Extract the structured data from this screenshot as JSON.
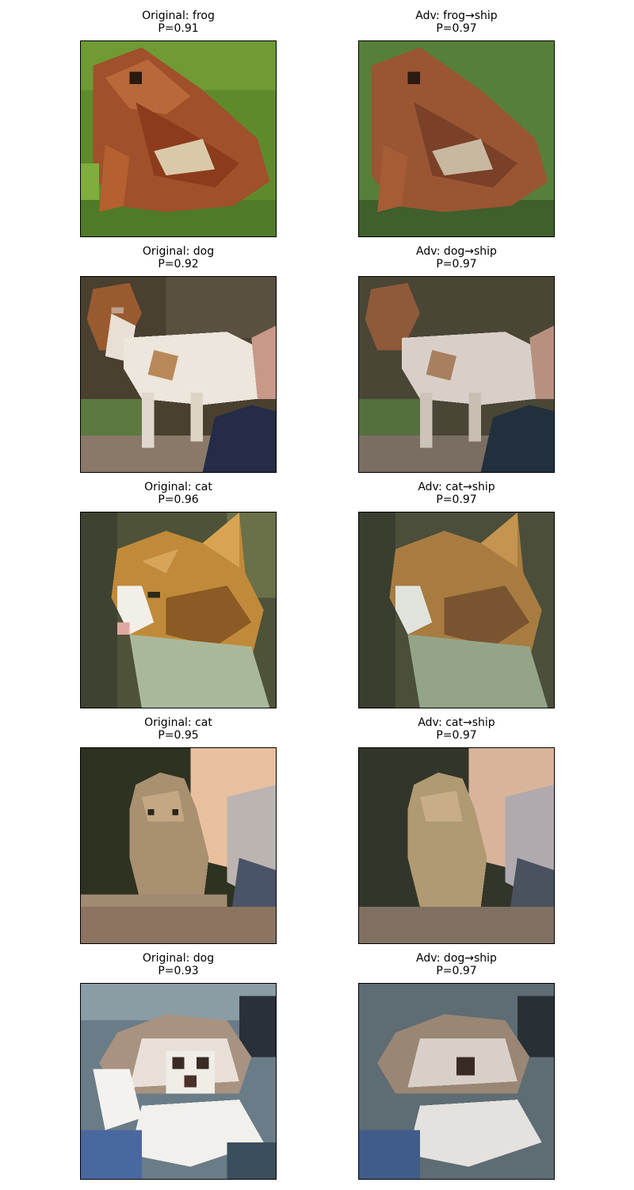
{
  "figure": {
    "rows": [
      {
        "original": {
          "label": "Original: frog",
          "prob": "P=0.91",
          "subject": "frog"
        },
        "adversarial": {
          "label": "Adv: frog→ship",
          "prob": "P=0.97",
          "subject": "frog"
        }
      },
      {
        "original": {
          "label": "Original: dog",
          "prob": "P=0.92",
          "subject": "dog"
        },
        "adversarial": {
          "label": "Adv: dog→ship",
          "prob": "P=0.97",
          "subject": "dog"
        }
      },
      {
        "original": {
          "label": "Original: cat",
          "prob": "P=0.96",
          "subject": "cat"
        },
        "adversarial": {
          "label": "Adv: cat→ship",
          "prob": "P=0.97",
          "subject": "cat"
        }
      },
      {
        "original": {
          "label": "Original: cat",
          "prob": "P=0.95",
          "subject": "cat"
        },
        "adversarial": {
          "label": "Adv: cat→ship",
          "prob": "P=0.97",
          "subject": "cat"
        }
      },
      {
        "original": {
          "label": "Original: dog",
          "prob": "P=0.93",
          "subject": "dog"
        },
        "adversarial": {
          "label": "Adv: dog→ship",
          "prob": "P=0.97",
          "subject": "dog"
        }
      }
    ]
  }
}
